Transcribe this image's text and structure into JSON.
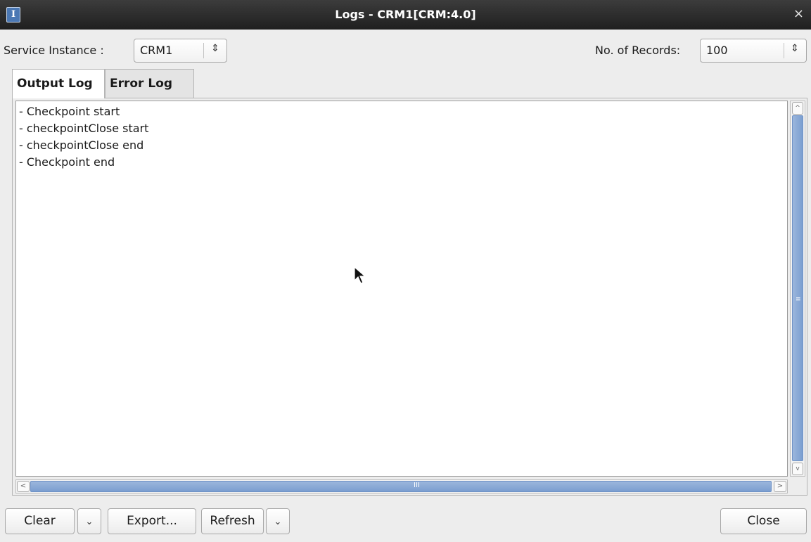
{
  "window": {
    "title": "Logs - CRM1[CRM:4.0]",
    "app_icon_glyph": "I",
    "close_glyph": "×"
  },
  "controls": {
    "service_instance_label": "Service Instance :",
    "service_instance_value": "CRM1",
    "records_label": "No. of Records:",
    "records_value": "100",
    "spinner_glyph": "⇕"
  },
  "tabs": [
    {
      "label": "Output Log",
      "active": true
    },
    {
      "label": "Error Log",
      "active": false
    }
  ],
  "log_lines": [
    "- Checkpoint start",
    "- checkpointClose start",
    "- checkpointClose end",
    "- Checkpoint end"
  ],
  "scroll": {
    "up_glyph": "^",
    "down_glyph": "v",
    "left_glyph": "<",
    "right_glyph": ">",
    "vgrip": "≡",
    "hgrip": "III"
  },
  "buttons": {
    "clear": "Clear",
    "dropdown_glyph": "⌄",
    "export": "Export...",
    "refresh": "Refresh",
    "close": "Close"
  },
  "icons": {
    "app": "app-logo-icon",
    "close": "close-icon",
    "spinner": "spinner-updown-icon",
    "dropdown": "chevron-down-icon",
    "cursor": "mouse-pointer-icon"
  }
}
